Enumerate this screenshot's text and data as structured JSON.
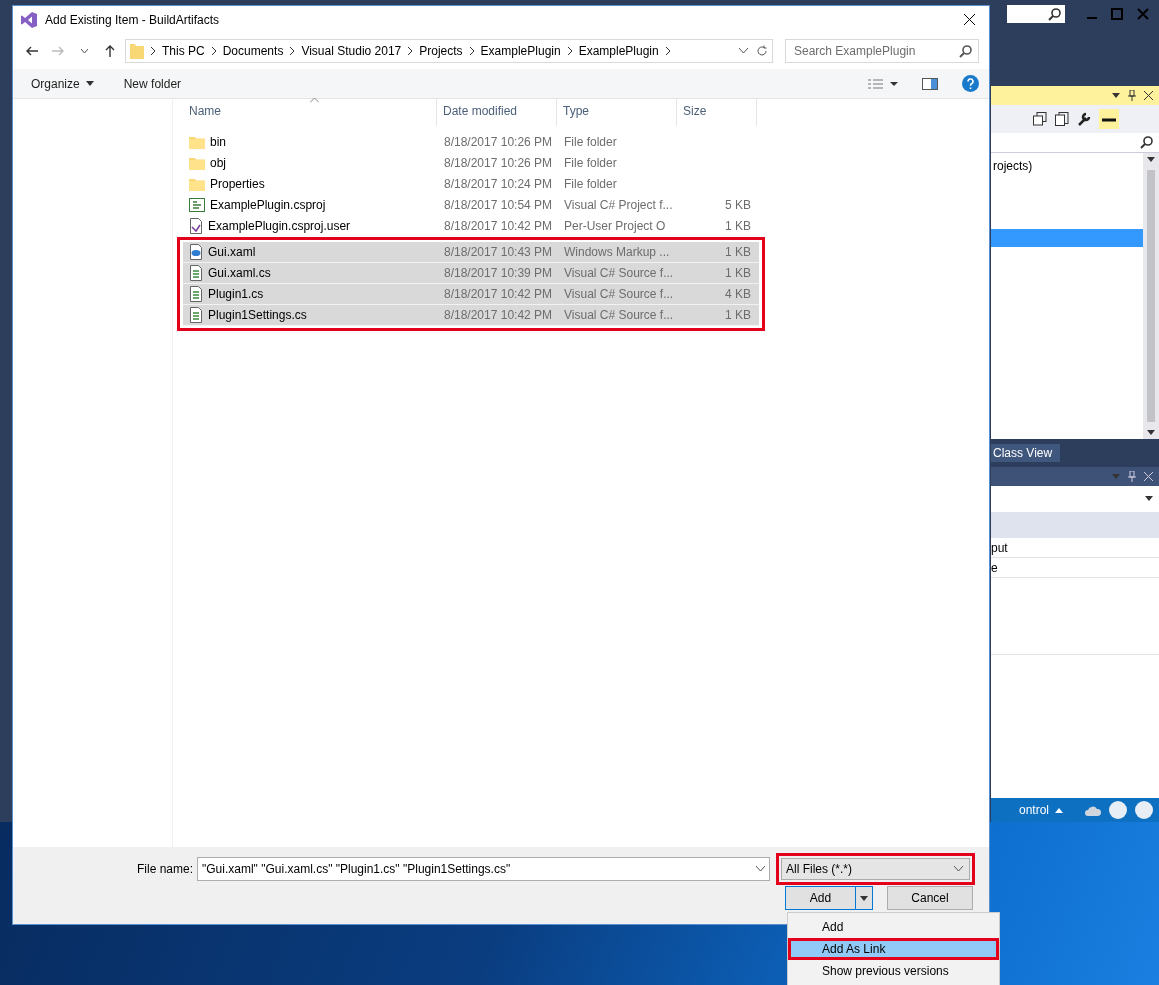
{
  "ide": {
    "explorer_text": "rojects)",
    "explorer_selected": true,
    "tab": "Class View",
    "property_rows": [
      "put",
      "e"
    ],
    "status_text": "ontrol"
  },
  "dialog": {
    "title": "Add Existing Item - BuildArtifacts",
    "breadcrumb": [
      "This PC",
      "Documents",
      "Visual Studio 2017",
      "Projects",
      "ExamplePlugin",
      "ExamplePlugin"
    ],
    "search": {
      "placeholder": "Search ExamplePlugin"
    },
    "toolbar": {
      "organize": "Organize",
      "new_folder": "New folder"
    },
    "columns": [
      "Name",
      "Date modified",
      "Type",
      "Size"
    ],
    "selection_highlighted": true,
    "rows": [
      {
        "name": "bin",
        "date": "8/18/2017 10:26 PM",
        "type": "File folder",
        "kind": "folder",
        "selected": false
      },
      {
        "name": "obj",
        "date": "8/18/2017 10:26 PM",
        "type": "File folder",
        "kind": "folder",
        "selected": false
      },
      {
        "name": "Properties",
        "date": "8/18/2017 10:24 PM",
        "type": "File folder",
        "kind": "folder",
        "selected": false
      },
      {
        "name": "ExamplePlugin.csproj",
        "date": "8/18/2017 10:54 PM",
        "type": "Visual C# Project f...",
        "size": "5 KB",
        "kind": "project",
        "selected": false
      },
      {
        "name": "ExamplePlugin.csproj.user",
        "date": "8/18/2017 10:42 PM",
        "type": "Per-User Project O",
        "size": "1 KB",
        "kind": "user",
        "selected": false
      },
      {
        "name": "Gui.xaml",
        "date": "8/18/2017 10:43 PM",
        "type": "Windows Markup ...",
        "size": "1 KB",
        "kind": "markup",
        "selected": true
      },
      {
        "name": "Gui.xaml.cs",
        "date": "8/18/2017 10:39 PM",
        "type": "Visual C# Source f...",
        "size": "1 KB",
        "kind": "source",
        "selected": true
      },
      {
        "name": "Plugin1.cs",
        "date": "8/18/2017 10:42 PM",
        "type": "Visual C# Source f...",
        "size": "4 KB",
        "kind": "source",
        "selected": true
      },
      {
        "name": "Plugin1Settings.cs",
        "date": "8/18/2017 10:42 PM",
        "type": "Visual C# Source f...",
        "size": "1 KB",
        "kind": "source",
        "selected": true
      }
    ],
    "file_name": {
      "label": "File name:",
      "value": "\"Gui.xaml\" \"Gui.xaml.cs\" \"Plugin1.cs\" \"Plugin1Settings.cs\""
    },
    "filter": {
      "label": "All Files (*.*)",
      "highlighted": true
    },
    "buttons": {
      "add": "Add",
      "cancel": "Cancel"
    },
    "menu": [
      {
        "label": "Add",
        "selected": false,
        "highlighted": false
      },
      {
        "label": "Add As Link",
        "selected": true,
        "highlighted": true
      },
      {
        "label": "Show previous versions",
        "selected": false,
        "highlighted": false
      }
    ]
  }
}
